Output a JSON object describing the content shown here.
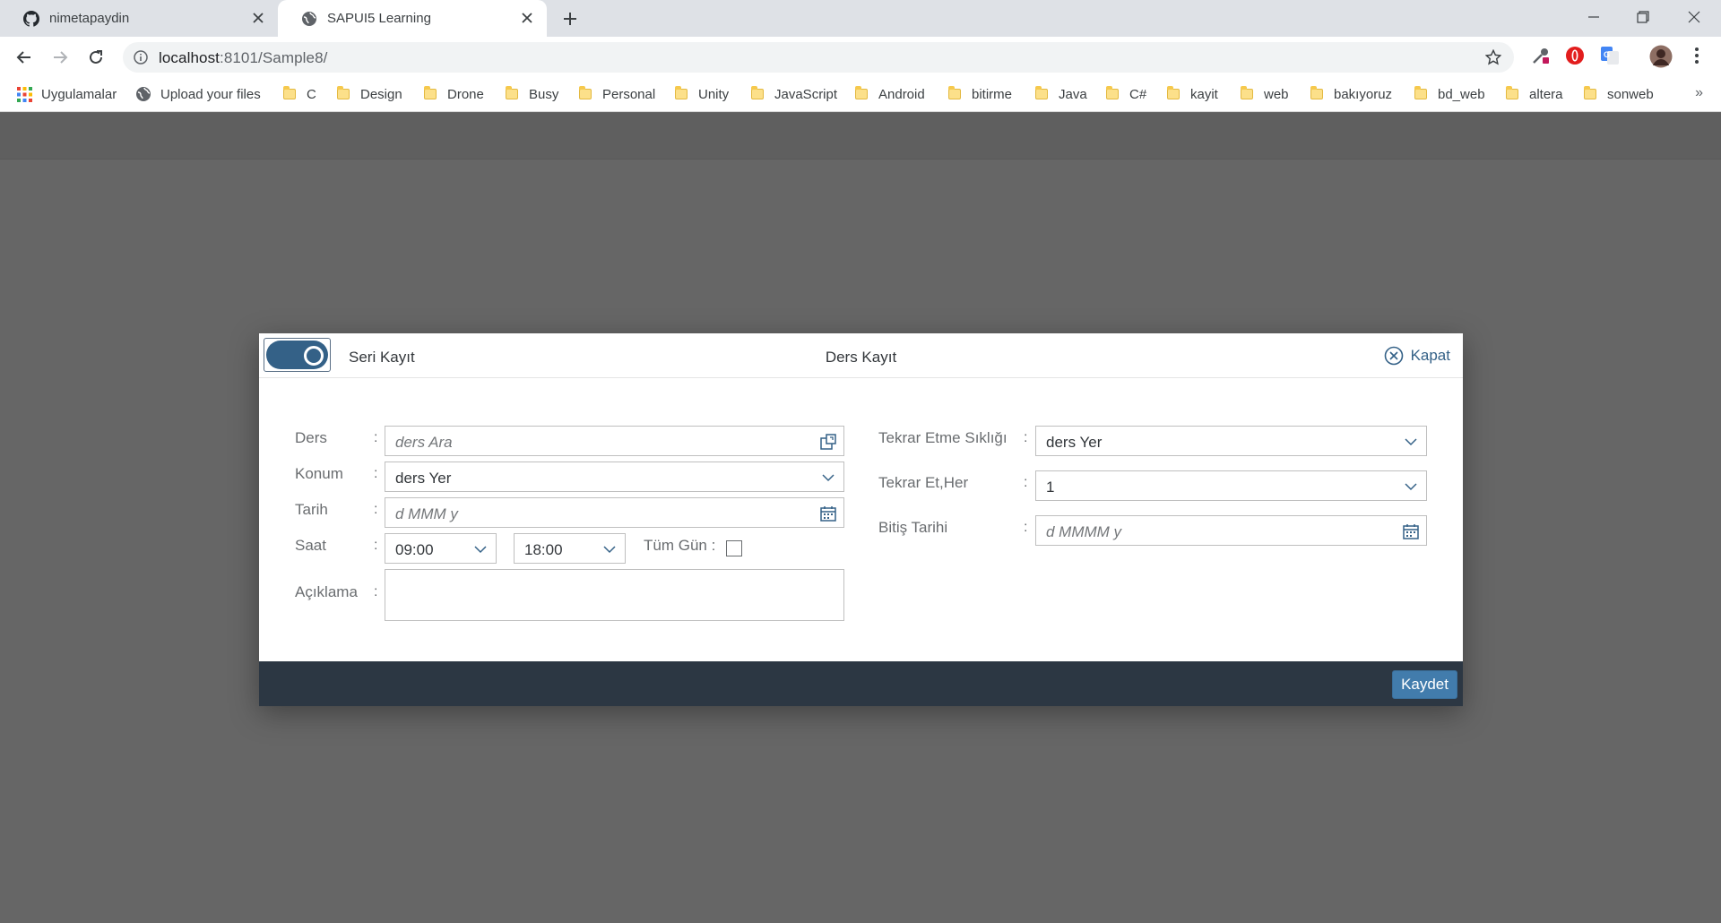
{
  "browser": {
    "tabs": [
      {
        "title": "nimetapaydin",
        "icon": "github-icon"
      },
      {
        "title": "SAPUI5 Learning",
        "icon": "globe-icon"
      }
    ],
    "address": {
      "host": "localhost",
      "path": ":8101/Sample8/"
    },
    "bookmarks": [
      {
        "label": "Uygulamalar",
        "icon": "apps-grid-icon"
      },
      {
        "label": "Upload your files",
        "icon": "globe-icon"
      },
      {
        "label": "C"
      },
      {
        "label": "Design"
      },
      {
        "label": "Drone"
      },
      {
        "label": "Busy"
      },
      {
        "label": "Personal"
      },
      {
        "label": "Unity"
      },
      {
        "label": "JavaScript"
      },
      {
        "label": "Android"
      },
      {
        "label": "bitirme"
      },
      {
        "label": "Java"
      },
      {
        "label": "C#"
      },
      {
        "label": "kayit"
      },
      {
        "label": "web"
      },
      {
        "label": "bakıyoruz"
      },
      {
        "label": "bd_web"
      },
      {
        "label": "altera"
      },
      {
        "label": "sonweb"
      }
    ],
    "bookmarks_more": "»"
  },
  "dialog": {
    "switch_label": "Seri Kayıt",
    "title": "Ders Kayıt",
    "close_label": "Kapat",
    "save_label": "Kaydet",
    "accent": "#346187",
    "left": {
      "ders": {
        "label": "Ders",
        "placeholder": "ders Ara",
        "icon": "value-help-icon"
      },
      "konum": {
        "label": "Konum",
        "value": "ders Yer",
        "icon": "chevron-down-icon"
      },
      "tarih": {
        "label": "Tarih",
        "placeholder": "d MMM y",
        "icon": "calendar-icon"
      },
      "saat": {
        "label": "Saat",
        "start": "09:00",
        "end": "18:00"
      },
      "tum_gun": {
        "label": "Tüm Gün :",
        "checked": false
      },
      "aciklama": {
        "label": "Açıklama",
        "value": ""
      }
    },
    "right": {
      "siklik": {
        "label": "Tekrar Etme Sıklığı",
        "value": "ders Yer",
        "icon": "chevron-down-icon"
      },
      "her": {
        "label": "Tekrar Et,Her",
        "value": "1",
        "icon": "chevron-down-icon"
      },
      "bitis": {
        "label": "Bitiş Tarihi",
        "placeholder": "d MMMM y",
        "icon": "calendar-icon"
      }
    },
    "colon": ":"
  }
}
